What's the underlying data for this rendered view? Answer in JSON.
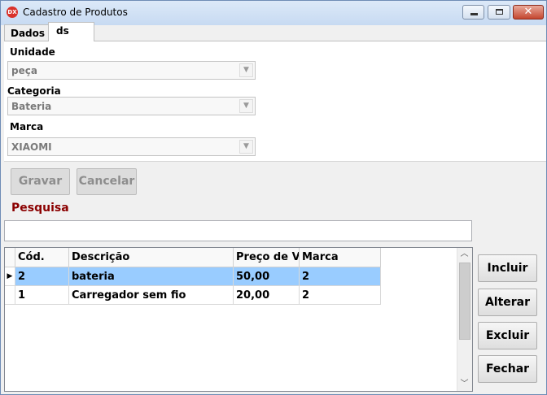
{
  "window": {
    "title": "Cadastro de Produtos",
    "icon_text": "DX",
    "close_glyph": "✕"
  },
  "tabs": [
    {
      "label": "Dados"
    },
    {
      "label": "ds"
    }
  ],
  "form": {
    "unidade": {
      "label": "Unidade",
      "value": "peça"
    },
    "categoria": {
      "label": "Categoria",
      "value": "Bateria"
    },
    "marca": {
      "label": "Marca",
      "value": "XIAOMI"
    }
  },
  "actions": {
    "gravar": "Gravar",
    "cancelar": "Cancelar"
  },
  "search": {
    "label": "Pesquisa",
    "value": "",
    "placeholder": ""
  },
  "grid": {
    "columns": [
      "Cód.",
      "Descrição",
      "Preço de V",
      "Marca"
    ],
    "rows": [
      {
        "cod": "2",
        "descricao": "bateria",
        "preco": "50,00",
        "marca": "2",
        "selected": true
      },
      {
        "cod": "1",
        "descricao": "Carregador sem fio",
        "preco": "20,00",
        "marca": "2",
        "selected": false
      }
    ]
  },
  "side_buttons": {
    "incluir": "Incluir",
    "alterar": "Alterar",
    "excluir": "Excluir",
    "fechar": "Fechar"
  },
  "icons": {
    "app": "dx-logo-icon",
    "minimize": "minimize-icon",
    "maximize": "maximize-icon",
    "close": "close-icon",
    "dropdown": "chevron-down-icon",
    "row_pointer": "row-pointer-icon",
    "scroll_up": "scroll-up-icon",
    "scroll_down": "scroll-down-icon"
  },
  "colors": {
    "section_label": "#8b0000",
    "selected_row": "#99ccff",
    "close_button": "#c4462f"
  }
}
